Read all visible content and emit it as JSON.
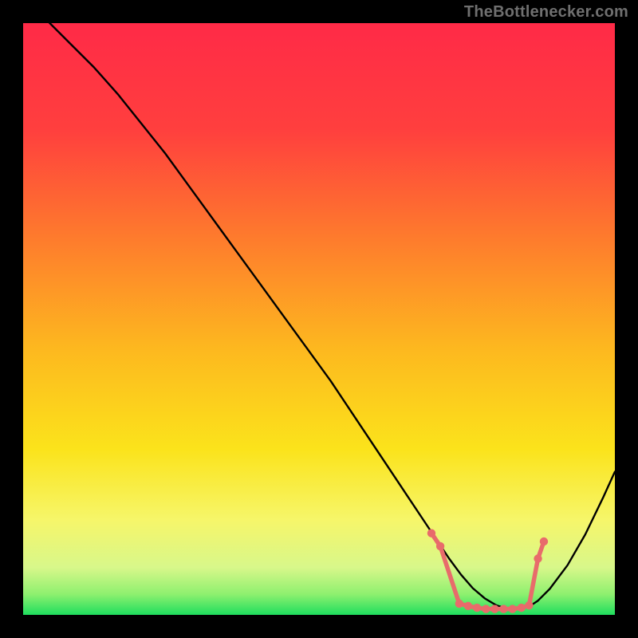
{
  "brand": {
    "watermark": "TheBottlenecker.com"
  },
  "palette": {
    "black": "#000000",
    "curve": "#000000",
    "marker": "#e86b6b",
    "gradient_stops": [
      {
        "offset": 0.0,
        "color": "#ff2a47"
      },
      {
        "offset": 0.18,
        "color": "#ff3f3e"
      },
      {
        "offset": 0.36,
        "color": "#fe7a2d"
      },
      {
        "offset": 0.55,
        "color": "#fdb81f"
      },
      {
        "offset": 0.72,
        "color": "#fbe31b"
      },
      {
        "offset": 0.84,
        "color": "#f6f66a"
      },
      {
        "offset": 0.92,
        "color": "#d8f78a"
      },
      {
        "offset": 0.965,
        "color": "#8ef06f"
      },
      {
        "offset": 1.0,
        "color": "#1fde5e"
      }
    ]
  },
  "chart_data": {
    "type": "line",
    "title": "",
    "xlabel": "",
    "ylabel": "",
    "xlim": [
      0,
      100
    ],
    "ylim": [
      0,
      100
    ],
    "grid": false,
    "legend": false,
    "series": [
      {
        "name": "bottleneck-curve",
        "x": [
          0,
          4,
          8,
          12,
          16,
          20,
          24,
          28,
          32,
          36,
          40,
          44,
          48,
          52,
          56,
          60,
          64,
          68,
          70,
          72,
          74,
          76,
          78,
          80,
          82,
          84,
          85.5,
          87,
          89,
          92,
          95,
          98,
          100
        ],
        "y": [
          105,
          100.5,
          96.5,
          92.5,
          88,
          83,
          78,
          72.5,
          67,
          61.5,
          56,
          50.5,
          45,
          39.5,
          33.5,
          27.5,
          21.5,
          15.5,
          12.5,
          9.5,
          6.8,
          4.5,
          2.8,
          1.6,
          1.0,
          1.0,
          1.4,
          2.4,
          4.4,
          8.4,
          13.6,
          19.8,
          24.2
        ]
      }
    ],
    "markers": {
      "name": "marked-range",
      "points": [
        {
          "x": 69.0,
          "y": 13.8
        },
        {
          "x": 70.5,
          "y": 11.6
        },
        {
          "x": 73.7,
          "y": 1.9
        },
        {
          "x": 75.2,
          "y": 1.5
        },
        {
          "x": 76.7,
          "y": 1.2
        },
        {
          "x": 78.2,
          "y": 1.0
        },
        {
          "x": 79.7,
          "y": 1.0
        },
        {
          "x": 81.2,
          "y": 1.0
        },
        {
          "x": 82.7,
          "y": 1.0
        },
        {
          "x": 84.2,
          "y": 1.2
        },
        {
          "x": 85.5,
          "y": 1.6
        },
        {
          "x": 87.0,
          "y": 9.5
        },
        {
          "x": 88.0,
          "y": 12.4
        }
      ]
    }
  }
}
